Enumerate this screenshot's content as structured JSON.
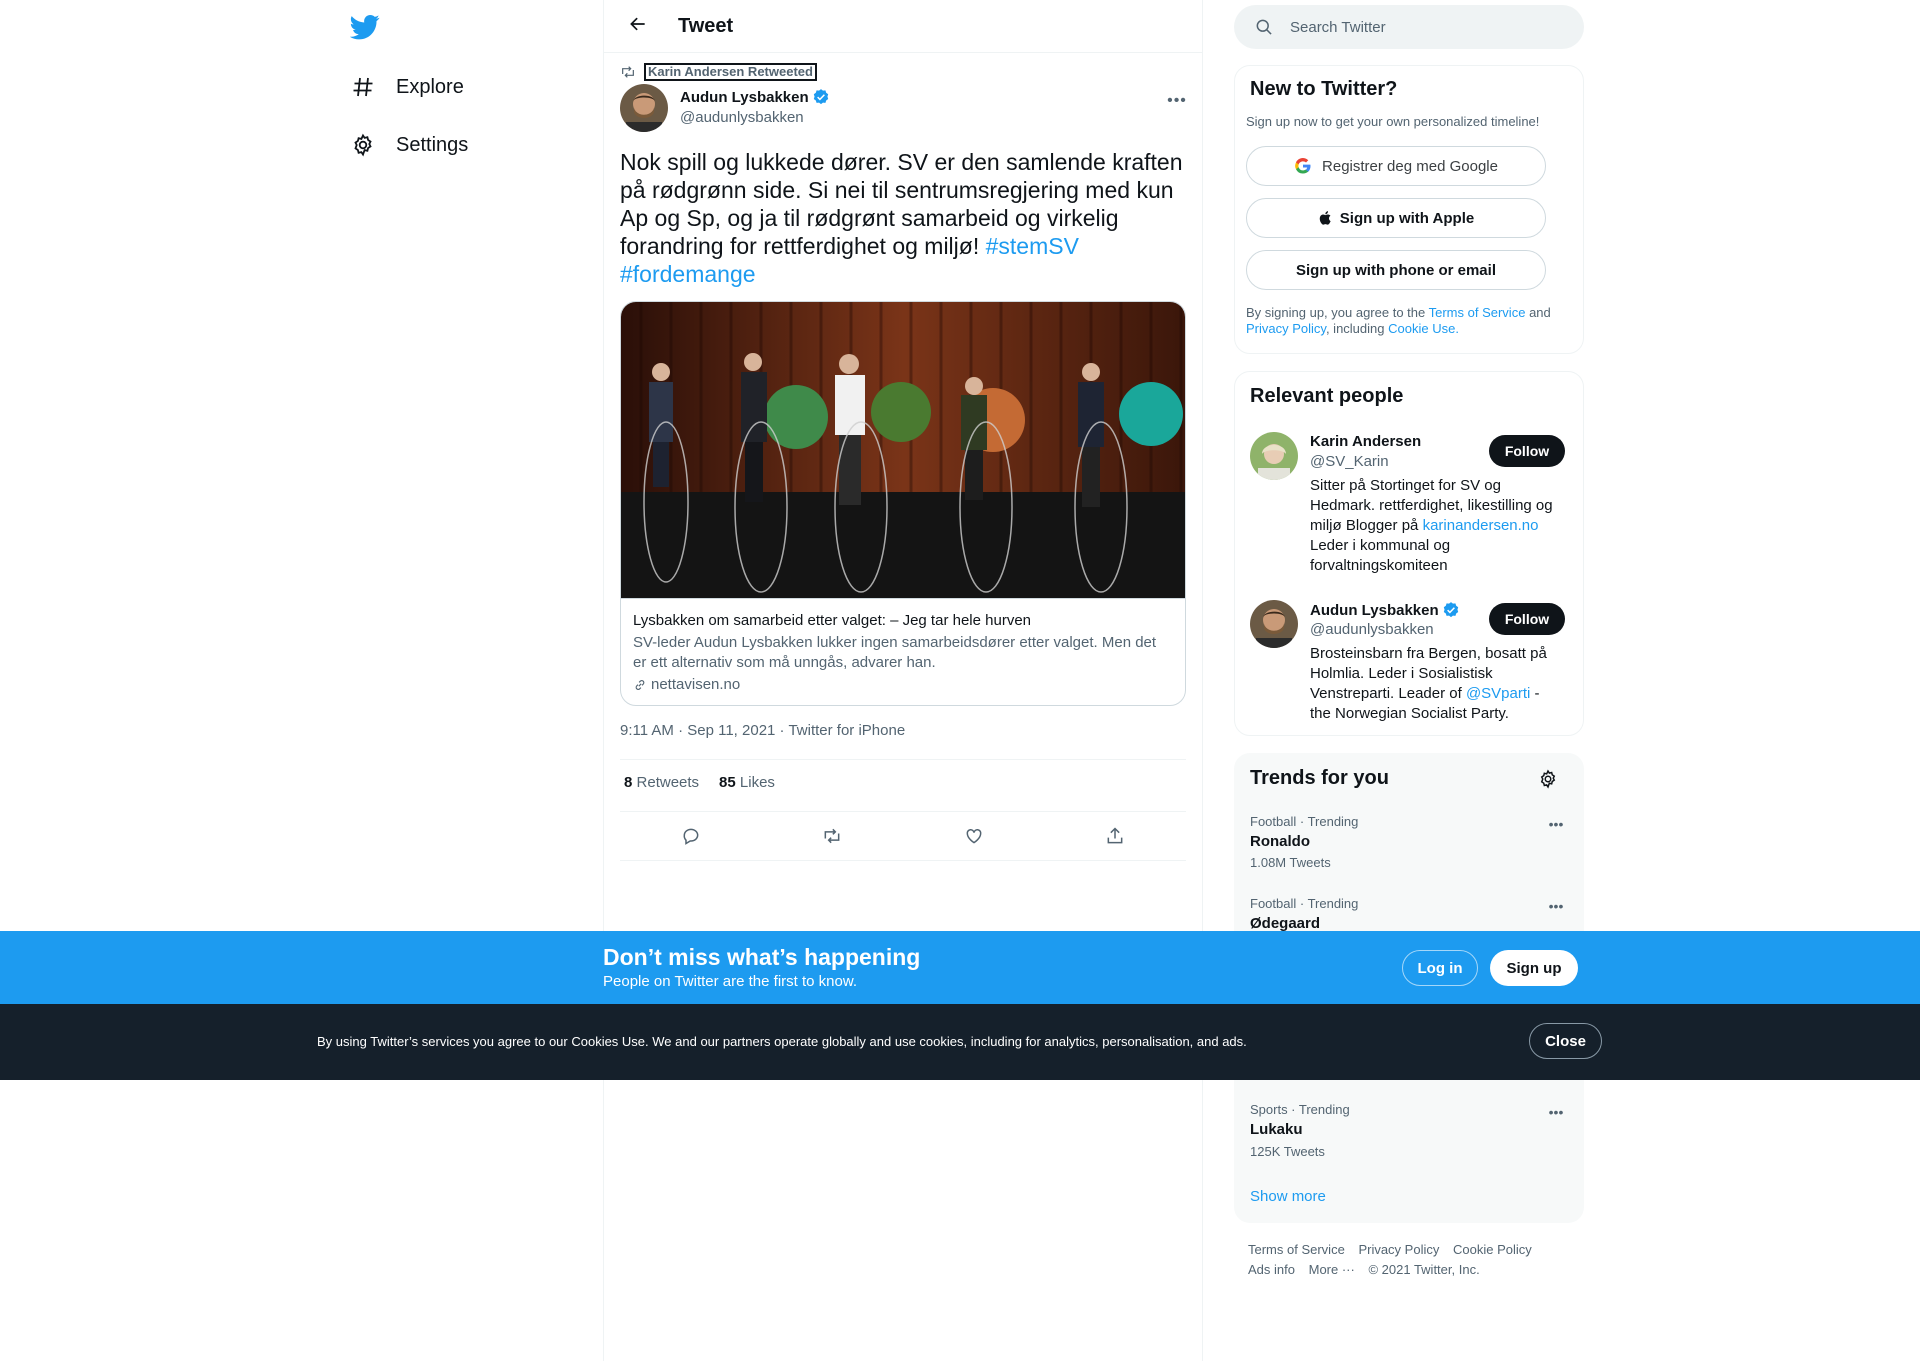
{
  "nav": {
    "logo": "twitter-bird-icon",
    "items": [
      {
        "label": "Explore",
        "icon": "hashtag-icon"
      },
      {
        "label": "Settings",
        "icon": "gear-icon"
      }
    ]
  },
  "header": {
    "title": "Tweet",
    "back_icon": "arrow-left-icon"
  },
  "tweet": {
    "retweeted_by": "Karin Andersen Retweeted",
    "author_name": "Audun Lysbakken",
    "author_handle": "@audunlysbakken",
    "verified": true,
    "text_lines": [
      "Nok spill og lukkede dører. SV er den samlende kraften",
      "på rødgrønn side. Si nei til sentrumsregjering med kun",
      "Ap og Sp, og ja til rødgrønt samarbeid og virkelig",
      "forandring for rettferdighet og miljø!"
    ],
    "hashtag1": "#stemSV",
    "hashtag2": "#fordemange",
    "card": {
      "title": "Lysbakken om samarbeid etter valget: – Jeg tar hele hurven",
      "description": "SV-leder Audun Lysbakken lukker ingen samarbeidsdører etter valget. Men det er ett alternativ som må unngås, advarer han.",
      "domain": "nettavisen.no"
    },
    "timestamp": "9:11 AM · Sep 11, 2021 · Twitter for iPhone",
    "retweets_count": "8",
    "retweets_label": "Retweets",
    "likes_count": "85",
    "likes_label": "Likes"
  },
  "search": {
    "placeholder": "Search Twitter"
  },
  "new_to_twitter": {
    "title": "New to Twitter?",
    "subtitle": "Sign up now to get your own personalized timeline!",
    "google_btn": "Registrer deg med Google",
    "apple_btn": "Sign up with Apple",
    "phone_btn": "Sign up with phone or email",
    "legal_1": "By signing up, you agree to the",
    "terms": "Terms of Service",
    "and": "and",
    "privacy": "Privacy Policy",
    "including": ", including",
    "cookie": "Cookie Use."
  },
  "relevant_people": {
    "title": "Relevant people",
    "people": [
      {
        "name": "Karin Andersen",
        "handle": "@SV_Karin",
        "follow": "Follow",
        "bio_a": "Sitter på Stortinget for SV og Hedmark. rettferdighet, likestilling og miljø Blogger på",
        "bio_link": "karinandersen.no",
        "bio_b": "Leder i kommunal og forvaltningskomiteen"
      },
      {
        "name": "Audun Lysbakken",
        "handle": "@audunlysbakken",
        "follow": "Follow",
        "bio_a": "Brosteinsbarn fra Bergen, bosatt på Holmlia. Leder i Sosialistisk Venstreparti. Leader of",
        "bio_link": "@SVparti",
        "bio_b": "- the Norwegian Socialist Party."
      }
    ]
  },
  "trends": {
    "title": "Trends for you",
    "items": [
      {
        "category": "Football · Trending",
        "name": "Ronaldo",
        "count": "1.08M Tweets"
      },
      {
        "category": "Football · Trending",
        "name": "Ødegaard",
        "count": ""
      },
      {
        "category": "Sports · Trending",
        "name": "Lukaku",
        "count": "125K Tweets"
      }
    ],
    "show_more": "Show more"
  },
  "footer": {
    "terms": "Terms of Service",
    "privacy": "Privacy Policy",
    "cookie": "Cookie Policy",
    "ads": "Ads info",
    "more": "More ···",
    "copyright": "© 2021 Twitter, Inc."
  },
  "banner": {
    "title": "Don’t miss what’s happening",
    "subtitle": "People on Twitter are the first to know.",
    "login": "Log in",
    "signup": "Sign up"
  },
  "cookie_bar": {
    "text": "By using Twitter’s services you agree to our Cookies Use. We and our partners operate globally and use cookies, including for analytics, personalisation, and ads.",
    "close": "Close"
  },
  "colors": {
    "accent": "#1d9bf0",
    "text": "#0f1419",
    "secondary": "#536471",
    "dark_bar": "#15202b"
  }
}
